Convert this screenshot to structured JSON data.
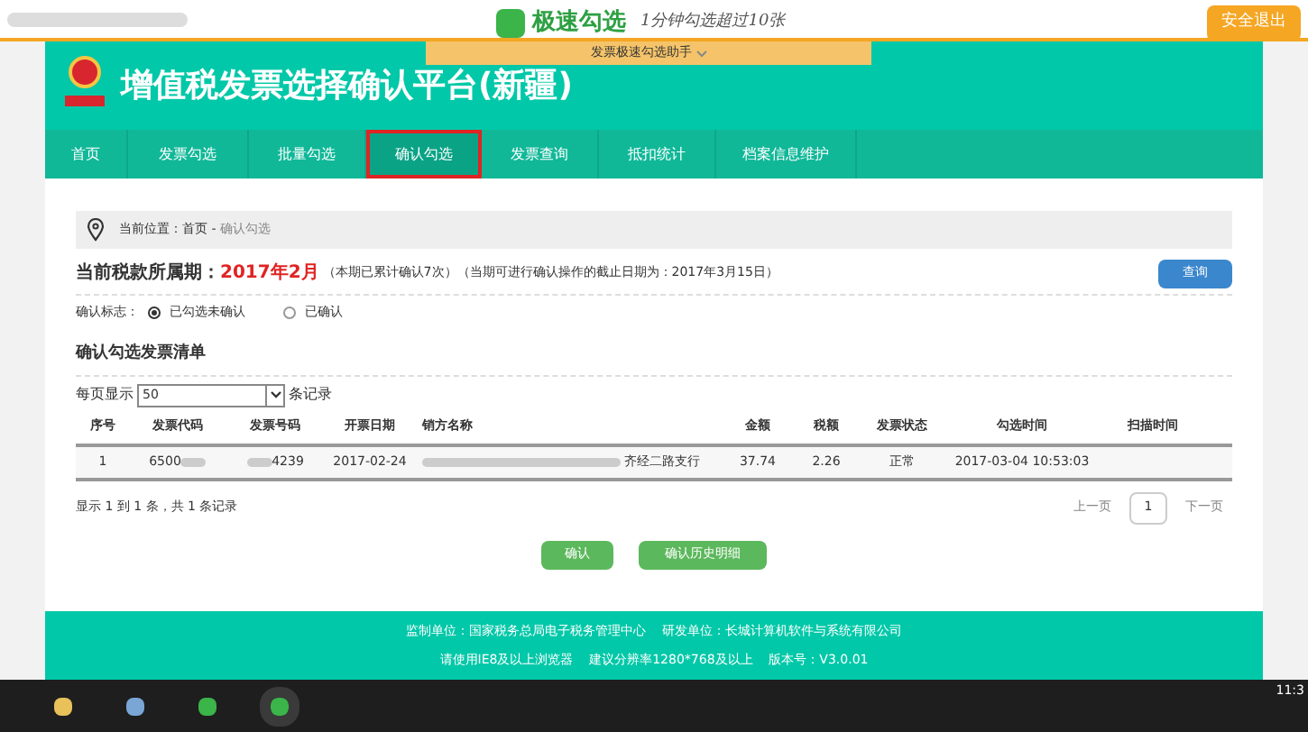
{
  "topbar": {
    "brand": "极速勾选",
    "slogan": "1分钟勾选超过10张",
    "logout": "安全退出",
    "helper_tab": "发票极速勾选助手"
  },
  "header": {
    "title": "增值税发票选择确认平台(新疆)"
  },
  "nav": [
    {
      "label": "首页",
      "selected": false
    },
    {
      "label": "发票勾选",
      "selected": false
    },
    {
      "label": "批量勾选",
      "selected": false
    },
    {
      "label": "确认勾选",
      "selected": true
    },
    {
      "label": "发票查询",
      "selected": false
    },
    {
      "label": "抵扣统计",
      "selected": false
    },
    {
      "label": "档案信息维护",
      "selected": false
    }
  ],
  "breadcrumb": {
    "prefix": "当前位置：",
    "home": "首页",
    "separator": "-",
    "current": "确认勾选"
  },
  "period": {
    "label": "当前税款所属期：",
    "value": "2017年2月",
    "note": "（本期已累计确认7次）（当期可进行确认操作的截止日期为：2017年3月15日）",
    "query_button": "查询"
  },
  "confirm_flag": {
    "label": "确认标志：",
    "options": [
      {
        "label": "已勾选未确认",
        "selected": true
      },
      {
        "label": "已确认",
        "selected": false
      }
    ]
  },
  "list": {
    "title": "确认勾选发票清单",
    "page_size_label": "每页显示",
    "page_size": "50",
    "page_size_suffix": "条记录",
    "columns": [
      "序号",
      "发票代码",
      "发票号码",
      "开票日期",
      "销方名称",
      "金额",
      "税额",
      "发票状态",
      "勾选时间",
      "扫描时间"
    ],
    "rows": [
      {
        "cells": [
          "1",
          "6500",
          "4239",
          "2017-02-24",
          "齐经二路支行",
          "37.74",
          "2.26",
          "正常",
          "2017-03-04 10:53:03",
          ""
        ]
      }
    ],
    "summary": "显示 1 到 1 条，共 1 条记录",
    "prev": "上一页",
    "page": "1",
    "next": "下一页"
  },
  "actions": [
    "确认",
    "确认历史明细"
  ],
  "footer": {
    "line_1": "监制单位：国家税务总局电子税务管理中心    研发单位：长城计算机软件与系统有限公司",
    "line_2": "请使用IE8及以上浏览器    建议分辨率1280*768及以上    版本号：V3.0.01"
  },
  "taskbar": {
    "clock": "11:3"
  }
}
